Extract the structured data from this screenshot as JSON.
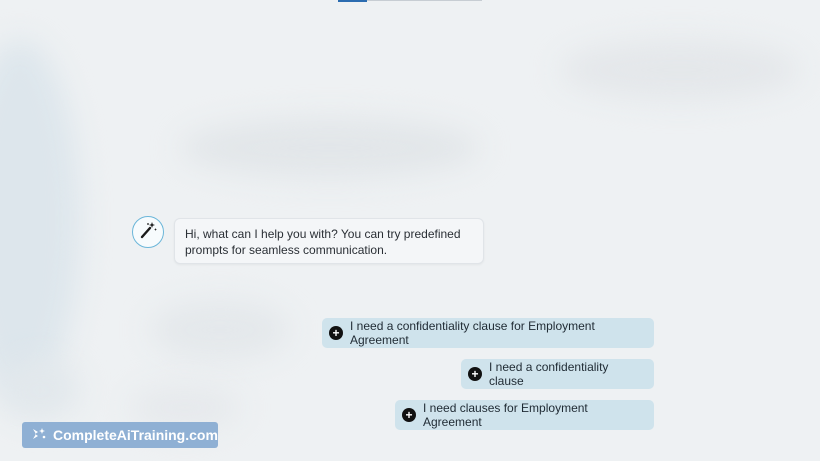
{
  "assistant": {
    "avatar_icon": "magic-wand-icon",
    "greeting": "Hi, what can I help you with? You can try predefined prompts for seamless communication."
  },
  "prompts": [
    {
      "label": "I need a confidentiality clause for Employment Agreement",
      "icon": "plus-circle-icon"
    },
    {
      "label": "I need a confidentiality clause",
      "icon": "plus-circle-icon"
    },
    {
      "label": "I need clauses for Employment Agreement",
      "icon": "plus-circle-icon"
    }
  ],
  "watermark": {
    "text": "CompleteAiTraining.com",
    "icon": "sparkle-logo-icon"
  },
  "colors": {
    "chip_bg": "#cfe3ec",
    "accent": "#6bb6d9",
    "watermark_bg": "#8fb0d4"
  }
}
